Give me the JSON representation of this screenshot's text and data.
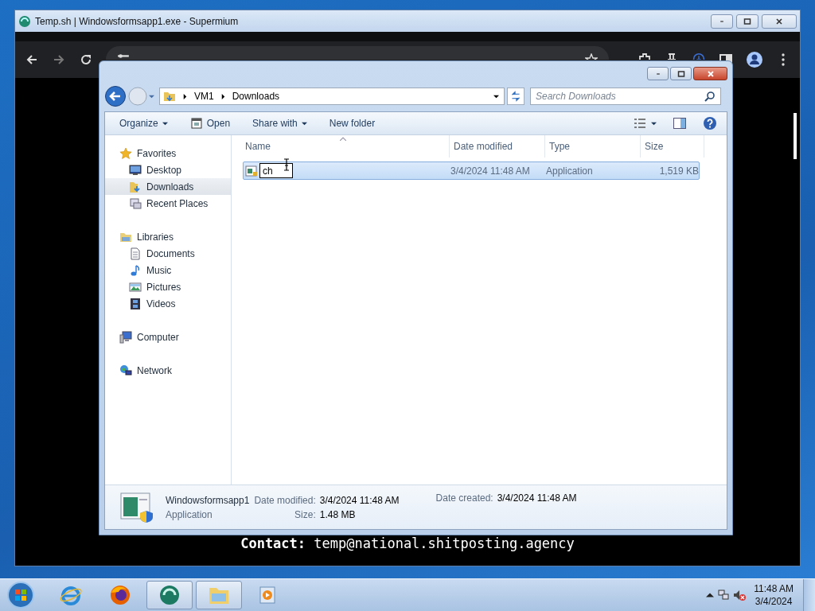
{
  "browser": {
    "title": "Temp.sh | Windowsformsapp1.exe - Supermium",
    "forward_disabled": true
  },
  "explorer": {
    "breadcrumb": [
      "VM1",
      "Downloads"
    ],
    "search": {
      "placeholder": "Search Downloads"
    },
    "toolbar": [
      {
        "label": "Organize",
        "dropdown": true,
        "icon": false
      },
      {
        "label": "Open",
        "dropdown": false,
        "icon": true
      },
      {
        "label": "Share with",
        "dropdown": true,
        "icon": false
      },
      {
        "label": "New folder",
        "dropdown": false,
        "icon": false
      }
    ],
    "nav": [
      {
        "label": "Favorites",
        "children": [
          {
            "label": "Desktop",
            "selected": false
          },
          {
            "label": "Downloads",
            "selected": true
          },
          {
            "label": "Recent Places",
            "selected": false
          }
        ]
      },
      {
        "label": "Libraries",
        "children": [
          {
            "label": "Documents",
            "selected": false
          },
          {
            "label": "Music",
            "selected": false
          },
          {
            "label": "Pictures",
            "selected": false
          },
          {
            "label": "Videos",
            "selected": false
          }
        ]
      },
      {
        "label": "Computer"
      },
      {
        "label": "Network"
      }
    ],
    "columns": [
      "Name",
      "Date modified",
      "Type",
      "Size"
    ],
    "rows": [
      {
        "name_value": "ch",
        "date": "3/4/2024 11:48 AM",
        "type": "Application",
        "size": "1,519 KB",
        "selected": true
      }
    ],
    "details": {
      "name": "Windowsformsapp1",
      "type": "Application",
      "fields": [
        {
          "label": "Date modified:",
          "value": "3/4/2024 11:48 AM"
        },
        {
          "label": "Date created:",
          "value": "3/4/2024 11:48 AM"
        },
        {
          "label": "Size:",
          "value": "1.48 MB"
        }
      ]
    }
  },
  "contact": {
    "label": "Contact:",
    "value": "temp@national.shitposting.agency"
  },
  "taskbar": {
    "apps": [
      {
        "active": false
      },
      {
        "active": false
      },
      {
        "active": true
      },
      {
        "active": true
      },
      {
        "active": false
      }
    ],
    "time": "11:48 AM",
    "date": "3/4/2024",
    "muted": true
  }
}
